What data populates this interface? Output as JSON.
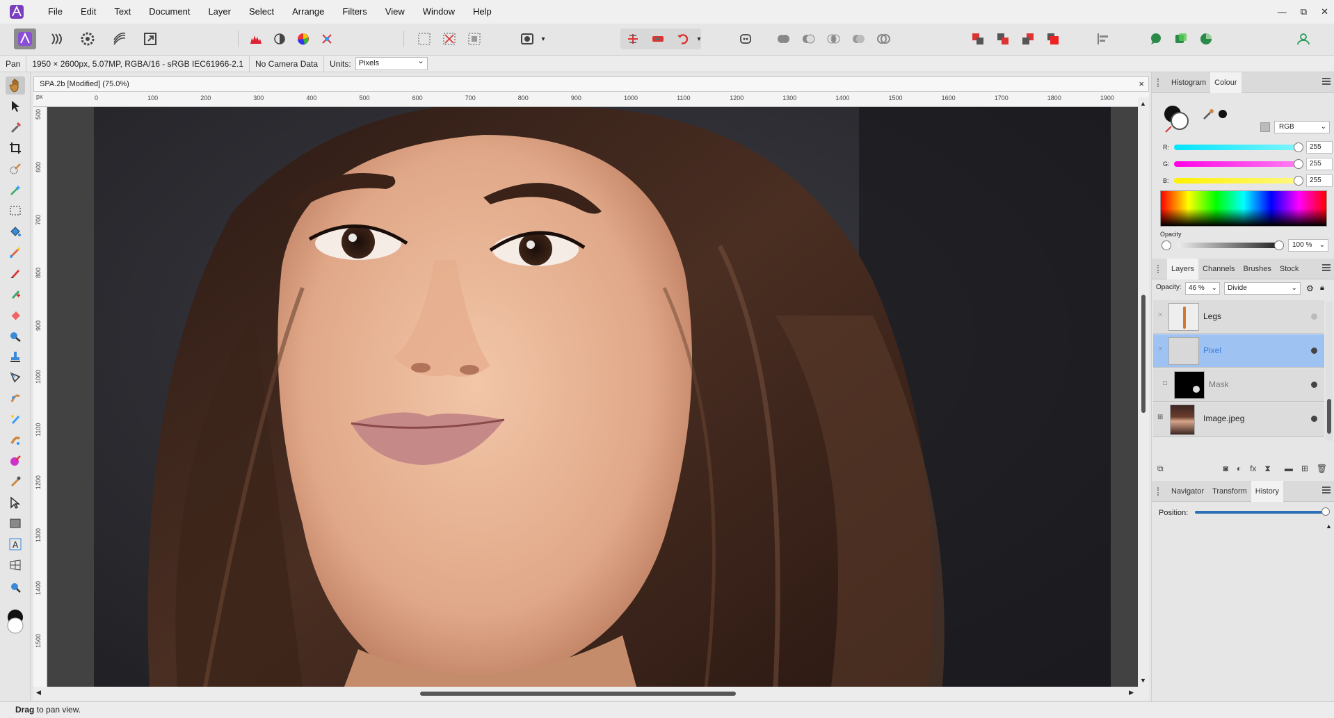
{
  "menu": [
    "File",
    "Edit",
    "Text",
    "Document",
    "Layer",
    "Select",
    "Arrange",
    "Filters",
    "View",
    "Window",
    "Help"
  ],
  "window_controls": [
    "—",
    "⧉",
    "✕"
  ],
  "context": {
    "tool": "Pan",
    "doc_info": "1950 × 2600px, 5.07MP, RGBA/16 - sRGB IEC61966-2.1",
    "camera": "No Camera Data",
    "units_label": "Units:",
    "units_value": "Pixels"
  },
  "document": {
    "tab_title": "SPA.2b [Modified] (75.0%)",
    "close": "×"
  },
  "ruler": {
    "unit": "px",
    "top_ticks": [
      "0",
      "100",
      "200",
      "300",
      "400",
      "500",
      "600",
      "700",
      "800",
      "900",
      "1000",
      "1100",
      "1200",
      "1300",
      "1400",
      "1500",
      "1600",
      "1700",
      "1800",
      "1900"
    ],
    "left_ticks": [
      "500",
      "600",
      "700",
      "800",
      "900",
      "1000",
      "1100",
      "1200",
      "1300",
      "1400",
      "1500"
    ]
  },
  "status": {
    "bold": "Drag",
    "text": " to pan view."
  },
  "colour_panel": {
    "tabs": [
      "Histogram",
      "Colour"
    ],
    "active_tab": "Colour",
    "model": "RGB",
    "channels": [
      {
        "label": "R:",
        "value": "255",
        "color": "#00e5ff"
      },
      {
        "label": "G:",
        "value": "255",
        "color": "#ff00e6"
      },
      {
        "label": "B:",
        "value": "255",
        "color": "#fff200"
      }
    ],
    "opacity_label": "Opacity",
    "opacity_value": "100 %"
  },
  "layers_panel": {
    "tabs": [
      "Layers",
      "Channels",
      "Brushes",
      "Stock"
    ],
    "active_tab": "Layers",
    "opacity_label": "Opacity:",
    "opacity_value": "46 %",
    "blend_mode": "Divide",
    "layers": [
      {
        "name": "Legs",
        "selected": false
      },
      {
        "name": "Pixel",
        "selected": true
      },
      {
        "name": "Mask",
        "selected": false
      },
      {
        "name": "Image.jpeg",
        "selected": false
      }
    ]
  },
  "history_panel": {
    "tabs": [
      "Navigator",
      "Transform",
      "History"
    ],
    "active_tab": "History",
    "position_label": "Position:"
  }
}
